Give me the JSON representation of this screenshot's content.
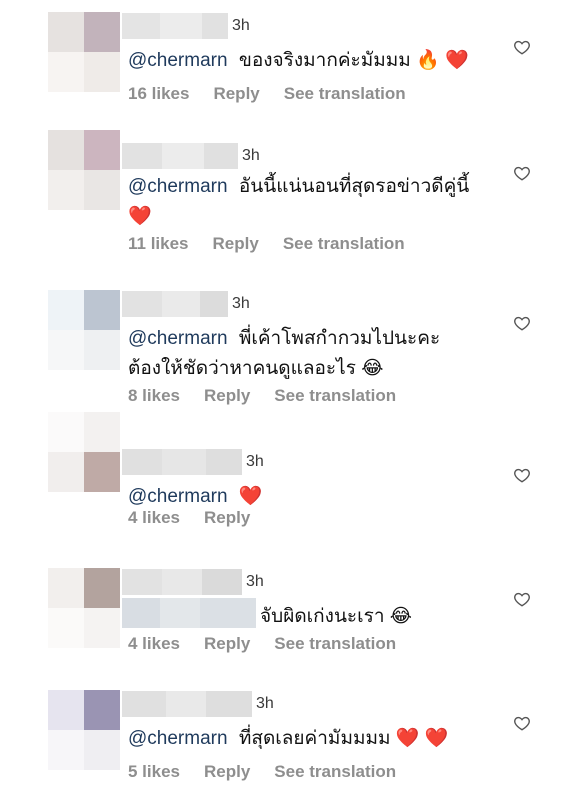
{
  "comments": [
    {
      "time": "3h",
      "mention": "@chermarn",
      "text": "ของจริงมากค่ะมัมมม",
      "emojis": "🔥 ❤️",
      "likes": "16 likes",
      "reply": "Reply",
      "translate": "See translation"
    },
    {
      "time": "3h",
      "mention": "@chermarn",
      "text": "อันนี้แน่นอนที่สุดรอข่าวดีคู่นี้",
      "emojis": "❤️",
      "likes": "11 likes",
      "reply": "Reply",
      "translate": "See translation"
    },
    {
      "time": "3h",
      "mention": "@chermarn",
      "text": "พี่เค้าโพสกำกวมไปนะคะ ต้องให้ชัดว่าหาคนดูแลอะไร",
      "emojis": "😂",
      "likes": "8 likes",
      "reply": "Reply",
      "translate": "See translation"
    },
    {
      "time": "3h",
      "mention": "@chermarn",
      "text": "",
      "emojis": "❤️",
      "likes": "4 likes",
      "reply": "Reply",
      "translate": ""
    },
    {
      "time": "3h",
      "mention": "",
      "text": "จับผิดเก่งนะเรา",
      "emojis": "😂",
      "likes": "4 likes",
      "reply": "Reply",
      "translate": "See translation"
    },
    {
      "time": "3h",
      "mention": "@chermarn",
      "text": "ที่สุดเลยค่ามัมมมม",
      "emojis": "❤️ ❤️",
      "likes": "5 likes",
      "reply": "Reply",
      "translate": "See translation"
    }
  ],
  "icons": {
    "like": "heart-outline-icon"
  },
  "colors": {
    "mention": "#1f3a5c",
    "meta": "#8e8e8e",
    "heart": "#e0243a"
  }
}
